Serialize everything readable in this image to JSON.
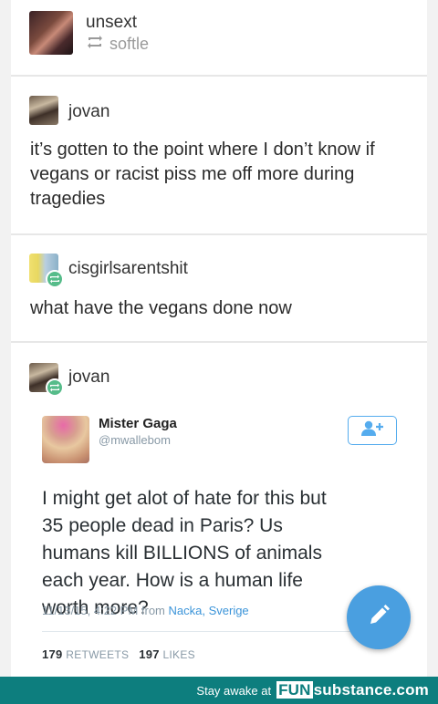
{
  "header": {
    "username": "unsext",
    "reblogged_from": "softle"
  },
  "posts": [
    {
      "username": "jovan",
      "text": "it’s gotten to the point where I don’t know if vegans or racist piss me off more during tragedies"
    },
    {
      "username": "cisgirlsarentshit",
      "text": "what have the vegans done now"
    },
    {
      "username": "jovan"
    }
  ],
  "tweet": {
    "name": "Mister Gaga",
    "handle": "@mwallebom",
    "text": "I might get alot of hate for this but 35 people dead in Paris? Us humans kill BILLIONS of animals each year. How is a human life worth more?",
    "date": "11/13/15, 4:22 PM from",
    "location": "Nacka, Sverige",
    "retweets_count": "179",
    "retweets_label": "RETWEETS",
    "likes_count": "197",
    "likes_label": "LIKES"
  },
  "footer": {
    "prefix": "Stay awake at",
    "brand_fun": "FUN",
    "brand_rest": "substance.com"
  },
  "colors": {
    "reblog_green": "#56bc8a",
    "twitter_blue": "#55acee",
    "fab_blue": "#4a9fe0",
    "footer_teal": "#0d7e7e"
  }
}
